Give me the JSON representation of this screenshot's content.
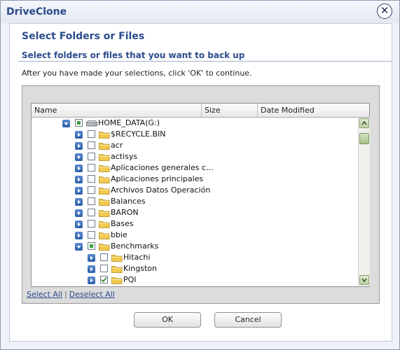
{
  "window": {
    "title": "DriveClone",
    "close_glyph": "✕"
  },
  "heading": "Select Folders or Files",
  "subheading": "Select folders or files that you want to back up",
  "instruction": "After you have made your selections, click 'OK' to continue.",
  "columns": [
    "Name",
    "Size",
    "Date Modified"
  ],
  "tree": [
    {
      "label": "HOME_DATA(G:)",
      "depth": 0,
      "expand": "expanded",
      "check": "partial",
      "icon": "drive-icon"
    },
    {
      "label": "$RECYCLE.BIN",
      "depth": 1,
      "expand": "collapsed",
      "check": "none",
      "icon": "folder-icon"
    },
    {
      "label": "acr",
      "depth": 1,
      "expand": "collapsed",
      "check": "none",
      "icon": "folder-icon"
    },
    {
      "label": "actisys",
      "depth": 1,
      "expand": "collapsed",
      "check": "none",
      "icon": "folder-icon"
    },
    {
      "label": "Aplicaciones generales c...",
      "depth": 1,
      "expand": "collapsed",
      "check": "none",
      "icon": "folder-icon"
    },
    {
      "label": "Aplicaciones principales",
      "depth": 1,
      "expand": "collapsed",
      "check": "none",
      "icon": "folder-icon"
    },
    {
      "label": "Archivos Datos Operación",
      "depth": 1,
      "expand": "collapsed",
      "check": "none",
      "icon": "folder-icon"
    },
    {
      "label": "Balances",
      "depth": 1,
      "expand": "collapsed",
      "check": "none",
      "icon": "folder-icon"
    },
    {
      "label": "BARON",
      "depth": 1,
      "expand": "collapsed",
      "check": "none",
      "icon": "folder-icon"
    },
    {
      "label": "Bases",
      "depth": 1,
      "expand": "collapsed",
      "check": "none",
      "icon": "folder-icon"
    },
    {
      "label": "bbie",
      "depth": 1,
      "expand": "collapsed",
      "check": "none",
      "icon": "folder-icon"
    },
    {
      "label": "Benchmarks",
      "depth": 1,
      "expand": "expanded",
      "check": "partial",
      "icon": "folder-icon"
    },
    {
      "label": "Hitachi",
      "depth": 2,
      "expand": "collapsed",
      "check": "none",
      "icon": "folder-icon"
    },
    {
      "label": "Kingston",
      "depth": 2,
      "expand": "collapsed",
      "check": "none",
      "icon": "folder-icon"
    },
    {
      "label": "PQI",
      "depth": 2,
      "expand": "collapsed",
      "check": "checked",
      "icon": "folder-icon"
    }
  ],
  "links": {
    "select_all": "Select All",
    "separator": "|",
    "deselect_all": "Deselect All"
  },
  "buttons": {
    "ok": "OK",
    "cancel": "Cancel"
  },
  "colors": {
    "title": "#2b4c8c",
    "partial": "#3f9e3f",
    "expander": "#2c5ea8",
    "folder": "#f2c94c"
  }
}
